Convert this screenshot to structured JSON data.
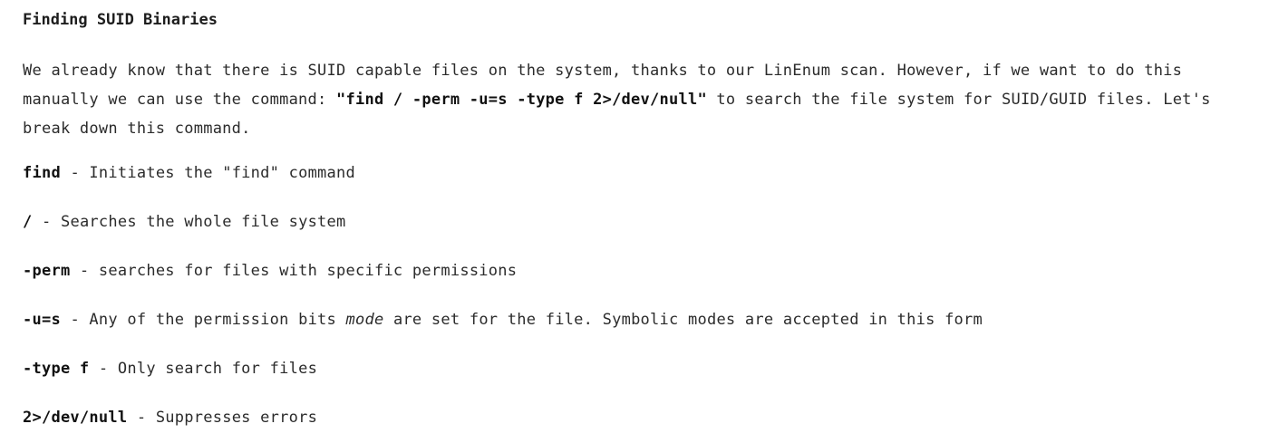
{
  "heading": "Finding SUID Binaries",
  "intro": {
    "part1": "We already know that there is SUID capable files on the system, thanks to our LinEnum scan. However, if we want to do this manually we can use the command: ",
    "command": "\"find / -perm -u=s -type f 2>/dev/null\"",
    "part2": " to search the file system for SUID/GUID files. Let's break down this command."
  },
  "definitions": [
    {
      "term": "find",
      "sep": " - ",
      "desc": "Initiates the \"find\" command"
    },
    {
      "term": "/",
      "sep": " - ",
      "desc": "Searches the whole file system"
    },
    {
      "term": "-perm",
      "sep": " - ",
      "desc": "searches for files with specific permissions"
    },
    {
      "term": "-u=s",
      "sep": " - ",
      "desc_before": "Any of the permission bits ",
      "desc_em": "mode",
      "desc_after": " are set for the file. Symbolic modes are accepted in this form"
    },
    {
      "term": "-type f",
      "sep": " - ",
      "desc": "Only search for files"
    },
    {
      "term": "2>/dev/null",
      "sep": " - ",
      "desc": "Suppresses errors"
    }
  ]
}
